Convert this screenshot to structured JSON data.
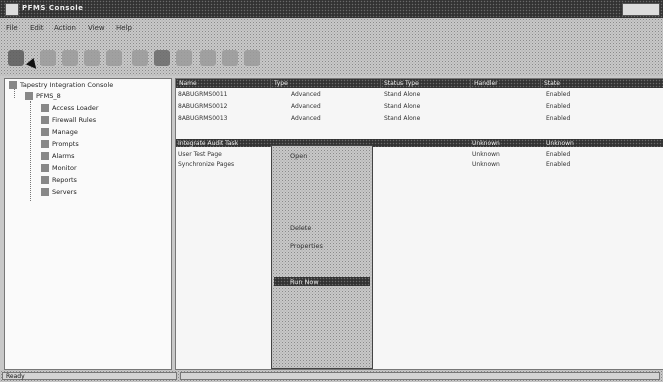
{
  "window": {
    "title": "PFMS Console"
  },
  "menu": [
    "File",
    "Edit",
    "Action",
    "View",
    "Help"
  ],
  "toolbar": {
    "icons": [
      "pointer-icon",
      "back-icon",
      "forward-icon",
      "up-icon",
      "refresh-icon",
      "export-icon",
      "properties-icon",
      "help-icon"
    ]
  },
  "tree": {
    "root": "Tapestry Integration Console",
    "node": "PFMS_8",
    "children": [
      "Access Loader",
      "Firewall Rules",
      "Manage",
      "Prompts",
      "Alarms",
      "Monitor",
      "Reports",
      "Servers"
    ]
  },
  "list": {
    "columns": [
      "Name",
      "Type",
      "Status Type",
      "Handler",
      "State"
    ],
    "rows": [
      [
        "8ABUGRMS0011",
        "Advanced",
        "Stand Alone",
        "",
        "Enabled"
      ],
      [
        "8ABUGRMS0012",
        "Advanced",
        "Stand Alone",
        "",
        "Enabled"
      ],
      [
        "8ABUGRMS0013",
        "Advanced",
        "Stand Alone",
        "",
        "Enabled"
      ],
      [
        "Integrate Audit Task",
        "",
        "",
        "Unknown",
        "Unknown"
      ],
      [
        "User Test Page",
        "",
        "",
        "Unknown",
        "Enabled"
      ],
      [
        "Synchronize Pages",
        "",
        "",
        "Unknown",
        "Enabled"
      ]
    ]
  },
  "context_menu": {
    "items": [
      "Open",
      "Delete",
      "Properties",
      "Run Now"
    ],
    "highlighted_index": 3
  },
  "status": {
    "text": "Ready",
    "panel2": ""
  }
}
